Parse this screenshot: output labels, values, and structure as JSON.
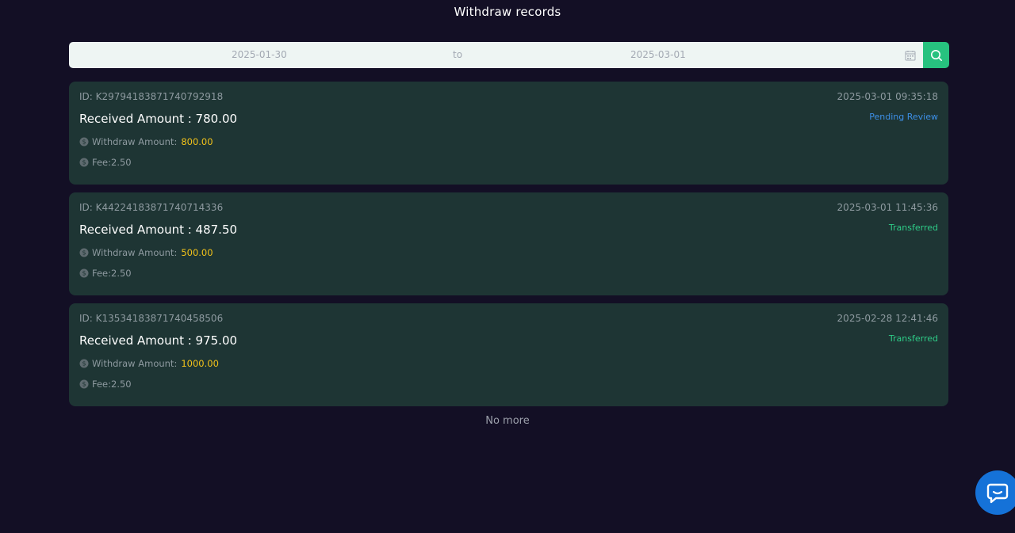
{
  "header": {
    "title": "Withdraw records"
  },
  "filter": {
    "start_date": "2025-01-30",
    "separator": "to",
    "end_date": "2025-03-01",
    "calendar_icon": "calendar-icon",
    "search_icon": "search-icon"
  },
  "records": [
    {
      "id": "ID: K2979418387174079291​8",
      "time": "2025-03-01 09:35:18",
      "received": "Received Amount : 780.00",
      "status": "Pending Review",
      "withdraw_label": "Withdraw Amount:",
      "withdraw_value": "800.00",
      "fee": "Fee:2.50"
    },
    {
      "id": "ID: K4422418387174071433​6",
      "time": "2025-03-01 11:45:36",
      "received": "Received Amount : 487.50",
      "status": "Transferred",
      "withdraw_label": "Withdraw Amount:",
      "withdraw_value": "500.00",
      "fee": "Fee:2.50"
    },
    {
      "id": "ID: K1353418387174045850​6",
      "time": "2025-02-28 12:41:46",
      "received": "Received Amount : 975.00",
      "status": "Transferred",
      "withdraw_label": "Withdraw Amount:",
      "withdraw_value": "1000.00",
      "fee": "Fee:2.50"
    }
  ],
  "footer": {
    "no_more": "No more"
  },
  "colors": {
    "background": "#130f25",
    "card": "#1e3534",
    "accent_green": "#27c27f",
    "pending_blue": "#3d8fe6",
    "amount_yellow": "#f2c21a",
    "chat_blue": "#1572d8"
  },
  "chat": {
    "icon": "chat-bubble-icon"
  }
}
